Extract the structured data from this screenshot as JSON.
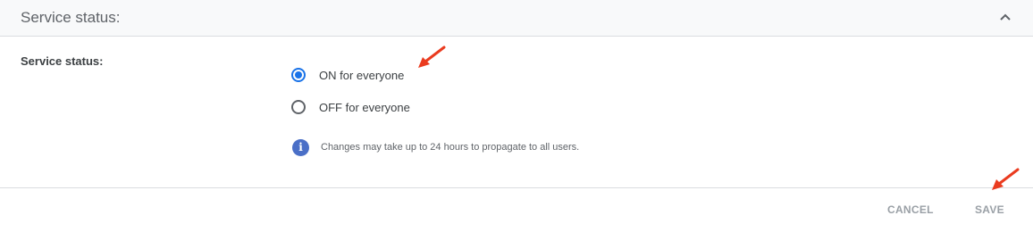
{
  "header": {
    "title": "Service status:",
    "collapse_icon": "chevron-up-icon"
  },
  "form": {
    "label": "Service status:",
    "options": [
      {
        "label": "ON for everyone",
        "selected": true
      },
      {
        "label": "OFF for everyone",
        "selected": false
      }
    ],
    "info_icon": "info-icon",
    "info_text": "Changes may take up to 24 hours to propagate to all users."
  },
  "footer": {
    "cancel_label": "CANCEL",
    "save_label": "SAVE"
  },
  "colors": {
    "accent": "#1a73e8",
    "annotation_arrow": "#ea3b1f",
    "disabled_text": "#9aa0a6",
    "info_icon": "#4a6fc7"
  }
}
